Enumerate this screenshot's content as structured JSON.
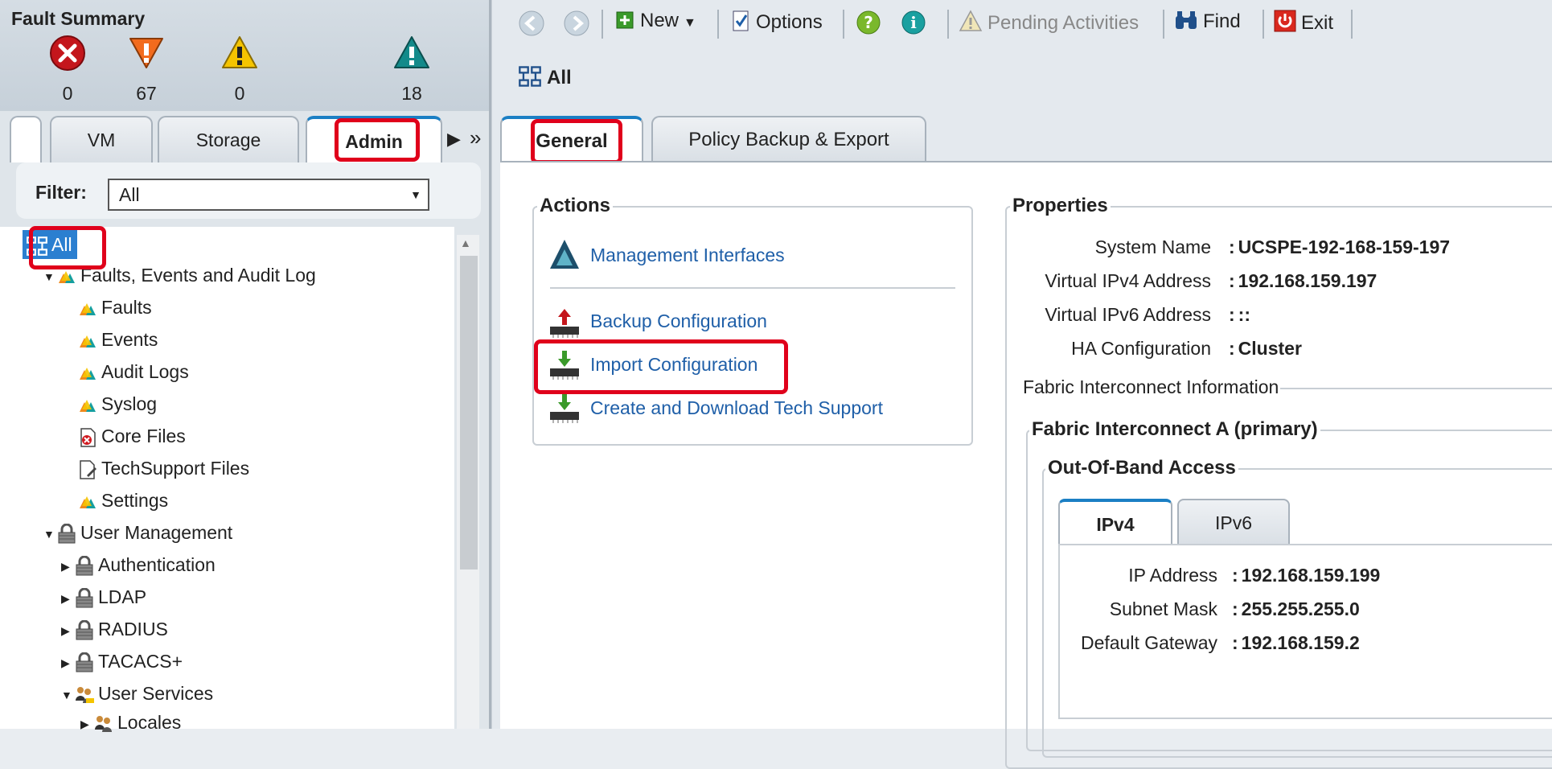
{
  "fault_summary": {
    "title": "Fault Summary",
    "items": [
      {
        "name": "critical",
        "count": "0",
        "color": "#c4161c"
      },
      {
        "name": "major",
        "count": "67",
        "color": "#f26b1d"
      },
      {
        "name": "minor",
        "count": "0",
        "color": "#f5c400"
      },
      {
        "name": "warning",
        "count": "18",
        "color": "#138a8a"
      }
    ]
  },
  "left_tabs": [
    {
      "label": "VM"
    },
    {
      "label": "Storage"
    },
    {
      "label": "Admin",
      "active": true
    }
  ],
  "filter": {
    "label": "Filter:",
    "value": "All"
  },
  "tree": {
    "root": "All",
    "nodes": [
      {
        "label": "Faults, Events and Audit Log"
      },
      {
        "label": "Faults"
      },
      {
        "label": "Events"
      },
      {
        "label": "Audit Logs"
      },
      {
        "label": "Syslog"
      },
      {
        "label": "Core Files"
      },
      {
        "label": "TechSupport Files"
      },
      {
        "label": "Settings"
      },
      {
        "label": "User Management"
      },
      {
        "label": "Authentication"
      },
      {
        "label": "LDAP"
      },
      {
        "label": "RADIUS"
      },
      {
        "label": "TACACS+"
      },
      {
        "label": "User Services"
      },
      {
        "label": "Locales"
      }
    ]
  },
  "toolbar": {
    "new": "New",
    "options": "Options",
    "pending": "Pending Activities",
    "find": "Find",
    "exit": "Exit"
  },
  "breadcrumb": "All",
  "right_tabs": [
    {
      "label": "General",
      "active": true
    },
    {
      "label": "Policy Backup & Export"
    }
  ],
  "actions": {
    "title": "Actions",
    "items": [
      {
        "label": "Management Interfaces"
      },
      {
        "label": "Backup Configuration"
      },
      {
        "label": "Import Configuration"
      },
      {
        "label": "Create and Download Tech Support"
      }
    ]
  },
  "properties": {
    "title": "Properties",
    "rows": [
      {
        "label": "System Name",
        "value": "UCSPE-192-168-159-197"
      },
      {
        "label": "Virtual IPv4 Address",
        "value": "192.168.159.197"
      },
      {
        "label": "Virtual IPv6 Address",
        "value": "::"
      },
      {
        "label": "HA Configuration",
        "value": "Cluster"
      }
    ],
    "fi_info": "Fabric Interconnect Information",
    "fi_a": "Fabric Interconnect A (primary)",
    "oob": "Out-Of-Band Access",
    "ip_tabs": [
      {
        "label": "IPv4",
        "active": true
      },
      {
        "label": "IPv6"
      }
    ],
    "oob_rows": [
      {
        "label": "IP Address",
        "value": "192.168.159.199"
      },
      {
        "label": "Subnet Mask",
        "value": "255.255.255.0"
      },
      {
        "label": "Default Gateway",
        "value": "192.168.159.2"
      }
    ]
  },
  "colors": {
    "highlight": "#e0001b",
    "link": "#1f5fa8",
    "tab_accent": "#1b7fc4"
  }
}
